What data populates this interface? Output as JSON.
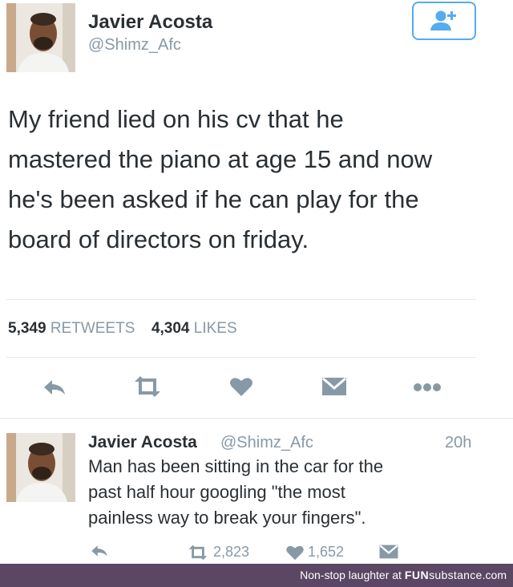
{
  "colors": {
    "accent": "#55acee",
    "text": "#292f33",
    "muted": "#8899a6",
    "divider": "#e1e8ed",
    "watermark_bg": "#5b4763"
  },
  "tweet": {
    "author_name": "Javier Acosta",
    "author_handle": "@Shimz_Afc",
    "follow_icon": "follow-user-icon",
    "text_lines": [
      "My friend lied on his cv that he",
      "mastered the piano at age 15 and now",
      "he's been asked if he can  play for the",
      "board of directors on friday."
    ],
    "retweet_count": "5,349",
    "retweet_label": "RETWEETS",
    "like_count": "4,304",
    "like_label": "LIKES",
    "actions": [
      "reply-icon",
      "retweet-icon",
      "heart-icon",
      "direct-message-icon",
      "more-icon"
    ]
  },
  "reply": {
    "author_name": "Javier Acosta",
    "author_handle": "@Shimz_Afc",
    "time": "20h",
    "text_lines": [
      "Man has been sitting in the car for the",
      "past half hour googling \"the most",
      "painless way to break your fingers\"."
    ],
    "retweet_count": "2,823",
    "like_count": "1,652"
  },
  "watermark": {
    "prefix": "Non-stop laughter at ",
    "brand_bold": "FUN",
    "brand_rest": "substance",
    "suffix": ".com"
  }
}
